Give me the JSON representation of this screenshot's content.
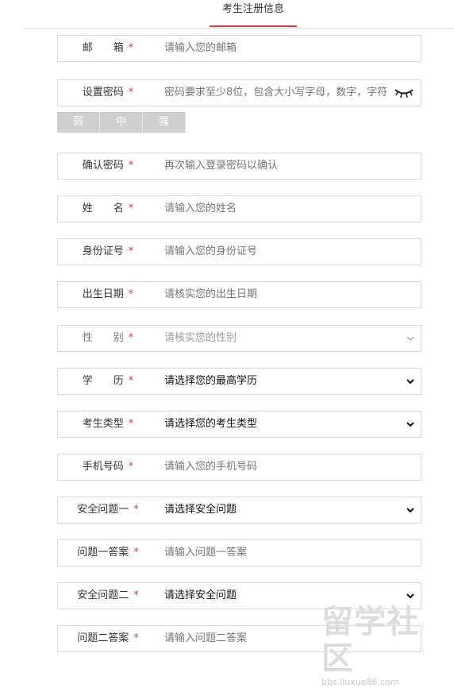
{
  "tab": {
    "label": "考生注册信息"
  },
  "colors": {
    "accent": "#e4393c",
    "border": "#d9d9d9",
    "strength_bg": "#cfcfcf"
  },
  "fields": {
    "email": {
      "label": "邮　　箱",
      "placeholder": "请输入您的邮箱"
    },
    "password": {
      "label": "设置密码",
      "placeholder": "密码要求至少8位，包含大小写字母，数字，字符"
    },
    "strength": [
      "弱",
      "中",
      "强"
    ],
    "confirm": {
      "label": "确认密码",
      "placeholder": "再次输入登录密码以确认"
    },
    "name": {
      "label": "姓　　名",
      "placeholder": "请输入您的姓名"
    },
    "idcard": {
      "label": "身份证号",
      "placeholder": "请输入您的身份证号"
    },
    "birth": {
      "label": "出生日期",
      "placeholder": "请核实您的出生日期"
    },
    "gender": {
      "label": "性　　别",
      "placeholder": "请核实您的性别"
    },
    "education": {
      "label": "学　　历",
      "value": "请选择您的最高学历"
    },
    "type": {
      "label": "考生类型",
      "value": "请选择您的考生类型"
    },
    "phone": {
      "label": "手机号码",
      "placeholder": "请输入您的手机号码"
    },
    "q1": {
      "label": "安全问题一",
      "value": "请选择安全问题"
    },
    "a1": {
      "label": "问题一答案",
      "placeholder": "请输入问题一答案"
    },
    "q2": {
      "label": "安全问题二",
      "value": "请选择安全问题"
    },
    "a2": {
      "label": "问题二答案",
      "placeholder": "请输入问题二答案"
    }
  },
  "required_mark": "*",
  "icons": {
    "eye": "eye-closed-icon",
    "chevron": "chevron-down-icon"
  },
  "watermark": {
    "text": "留学社区",
    "url": "bbs.liuxue86.com"
  }
}
